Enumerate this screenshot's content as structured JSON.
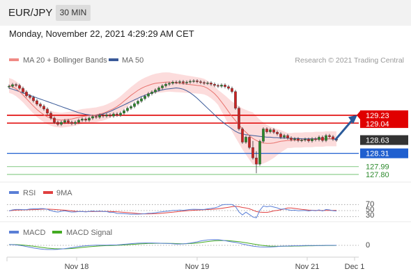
{
  "header": {
    "symbol": "EUR/JPY",
    "timeframe": "30 MIN",
    "datetime": "Monday, November 22, 2021 4:29:29 AM CET"
  },
  "colors": {
    "ma20": "#e8736e",
    "band_fill": "#fbd6d6",
    "ma50": "#3a5a99",
    "resistance": "#e00000",
    "pivot": "#1f5fcf",
    "support": "#8fcf8f",
    "candle_up": "#2a8a2a",
    "candle_down": "#cc2222",
    "arrow": "#2a5a9a",
    "rsi": "#5a7fd6",
    "rsi_ma": "#e04040",
    "macd": "#5a7fd6",
    "macd_signal": "#44aa22"
  },
  "main_chart": {
    "legend": [
      {
        "label": "MA 20 + Bollinger Bands",
        "color": "#f08a85"
      },
      {
        "label": "MA 50",
        "color": "#3a5a99"
      }
    ],
    "credit": "Research © 2021 Trading Central",
    "levels": [
      {
        "label": "129.23",
        "kind": "resistance"
      },
      {
        "label": "129.04",
        "kind": "resistance"
      },
      {
        "label": "128.63",
        "kind": "last"
      },
      {
        "label": "128.31",
        "kind": "pivot"
      },
      {
        "label": "127.99",
        "kind": "support"
      },
      {
        "label": "127.80",
        "kind": "support"
      }
    ]
  },
  "rsi_panel": {
    "legend": [
      {
        "label": "RSI",
        "color": "#5a7fd6"
      },
      {
        "label": "9MA",
        "color": "#e04040"
      }
    ],
    "ticks": [
      "70",
      "50",
      "30"
    ]
  },
  "macd_panel": {
    "legend": [
      {
        "label": "MACD",
        "color": "#5a7fd6"
      },
      {
        "label": "MACD Signal",
        "color": "#44aa22"
      }
    ],
    "ticks": [
      "0"
    ]
  },
  "x_axis": [
    "Nov 18",
    "Nov 19",
    "Nov 21",
    "Dec 1"
  ],
  "chart_data": {
    "type": "candlestick",
    "x_labels": [
      "Nov 18",
      "Nov 19",
      "Nov 21",
      "Dec 1"
    ],
    "price_range": [
      127.8,
      130.2
    ],
    "close": [
      129.93,
      129.97,
      129.95,
      129.88,
      129.79,
      129.7,
      129.66,
      129.58,
      129.5,
      129.45,
      129.38,
      129.28,
      129.16,
      129.06,
      129.01,
      129.06,
      129.1,
      129.06,
      129.03,
      129.06,
      129.11,
      129.14,
      129.11,
      129.16,
      129.2,
      129.18,
      129.23,
      129.21,
      129.24,
      129.21,
      129.26,
      129.23,
      129.28,
      129.34,
      129.4,
      129.44,
      129.51,
      129.57,
      129.63,
      129.69,
      129.75,
      129.79,
      129.84,
      129.89,
      129.94,
      129.98,
      130.0,
      130.03,
      130.02,
      130.04,
      130.01,
      130.03,
      130.05,
      130.06,
      130.04,
      130.02,
      130.0,
      130.01,
      129.98,
      129.95,
      129.93,
      129.96,
      129.92,
      129.88,
      129.8,
      129.4,
      128.9,
      128.58,
      128.7,
      128.45,
      128.2,
      128.05,
      128.6,
      128.9,
      128.83,
      128.88,
      128.82,
      128.78,
      128.7,
      128.74,
      128.68,
      128.64,
      128.66,
      128.62,
      128.63,
      128.65,
      128.61,
      128.66,
      128.64,
      128.7,
      128.62,
      128.74,
      128.71,
      128.65,
      128.63
    ],
    "ma20": [
      129.95,
      129.92,
      129.87,
      129.8,
      129.72,
      129.63,
      129.54,
      129.45,
      129.37,
      129.3,
      129.24,
      129.19,
      129.16,
      129.13,
      129.12,
      129.11,
      129.12,
      129.13,
      129.14,
      129.16,
      129.18,
      129.2,
      129.21,
      129.22,
      129.23,
      129.24,
      129.26,
      129.28,
      129.31,
      129.35,
      129.39,
      129.44,
      129.5,
      129.57,
      129.64,
      129.71,
      129.77,
      129.83,
      129.88,
      129.92,
      129.95,
      129.98,
      130.0,
      130.01,
      130.02,
      130.03,
      130.03,
      130.02,
      130.01,
      130.0,
      129.99,
      129.98,
      129.97,
      129.96,
      129.95,
      129.94,
      129.92,
      129.88,
      129.82,
      129.75,
      129.66,
      129.55,
      129.44,
      129.32,
      129.2,
      129.1,
      129.0,
      128.9,
      128.82,
      128.74,
      128.67,
      128.62,
      128.58,
      128.56,
      128.55,
      128.55,
      128.56,
      128.58,
      128.6,
      128.61,
      128.62,
      128.62,
      128.63,
      128.63,
      128.63,
      128.64,
      128.64,
      128.64,
      128.65,
      128.65,
      128.65,
      128.66,
      128.66,
      128.66,
      128.66
    ],
    "ma50": [
      129.88,
      129.86,
      129.83,
      129.8,
      129.77,
      129.74,
      129.71,
      129.68,
      129.65,
      129.62,
      129.59,
      129.56,
      129.53,
      129.5,
      129.47,
      129.44,
      129.41,
      129.38,
      129.35,
      129.32,
      129.29,
      129.27,
      129.25,
      129.24,
      129.23,
      129.23,
      129.24,
      129.26,
      129.29,
      129.32,
      129.36,
      129.4,
      129.44,
      129.48,
      129.52,
      129.56,
      129.6,
      129.64,
      129.68,
      129.71,
      129.74,
      129.77,
      129.8,
      129.82,
      129.84,
      129.86,
      129.87,
      129.88,
      129.89,
      129.88,
      129.86,
      129.82,
      129.77,
      129.71,
      129.64,
      129.56,
      129.48,
      129.4,
      129.32,
      129.24,
      129.16,
      129.09,
      129.02,
      128.96,
      128.9,
      128.84,
      128.8,
      128.78,
      128.76,
      128.75,
      128.74,
      128.73,
      128.72,
      128.71,
      128.7,
      128.7,
      128.69,
      128.69,
      128.68,
      128.68,
      128.68,
      128.67,
      128.67,
      128.67,
      128.66,
      128.66,
      128.66,
      128.66,
      128.66,
      128.66,
      128.66,
      128.66,
      128.66,
      128.66,
      128.66
    ],
    "resistance_levels": [
      129.23,
      129.04
    ],
    "last_price": 128.63,
    "pivot": 128.31,
    "support_levels": [
      127.99,
      127.8
    ],
    "rsi_levels": [
      70,
      50,
      30
    ],
    "macd_zero": 0
  }
}
